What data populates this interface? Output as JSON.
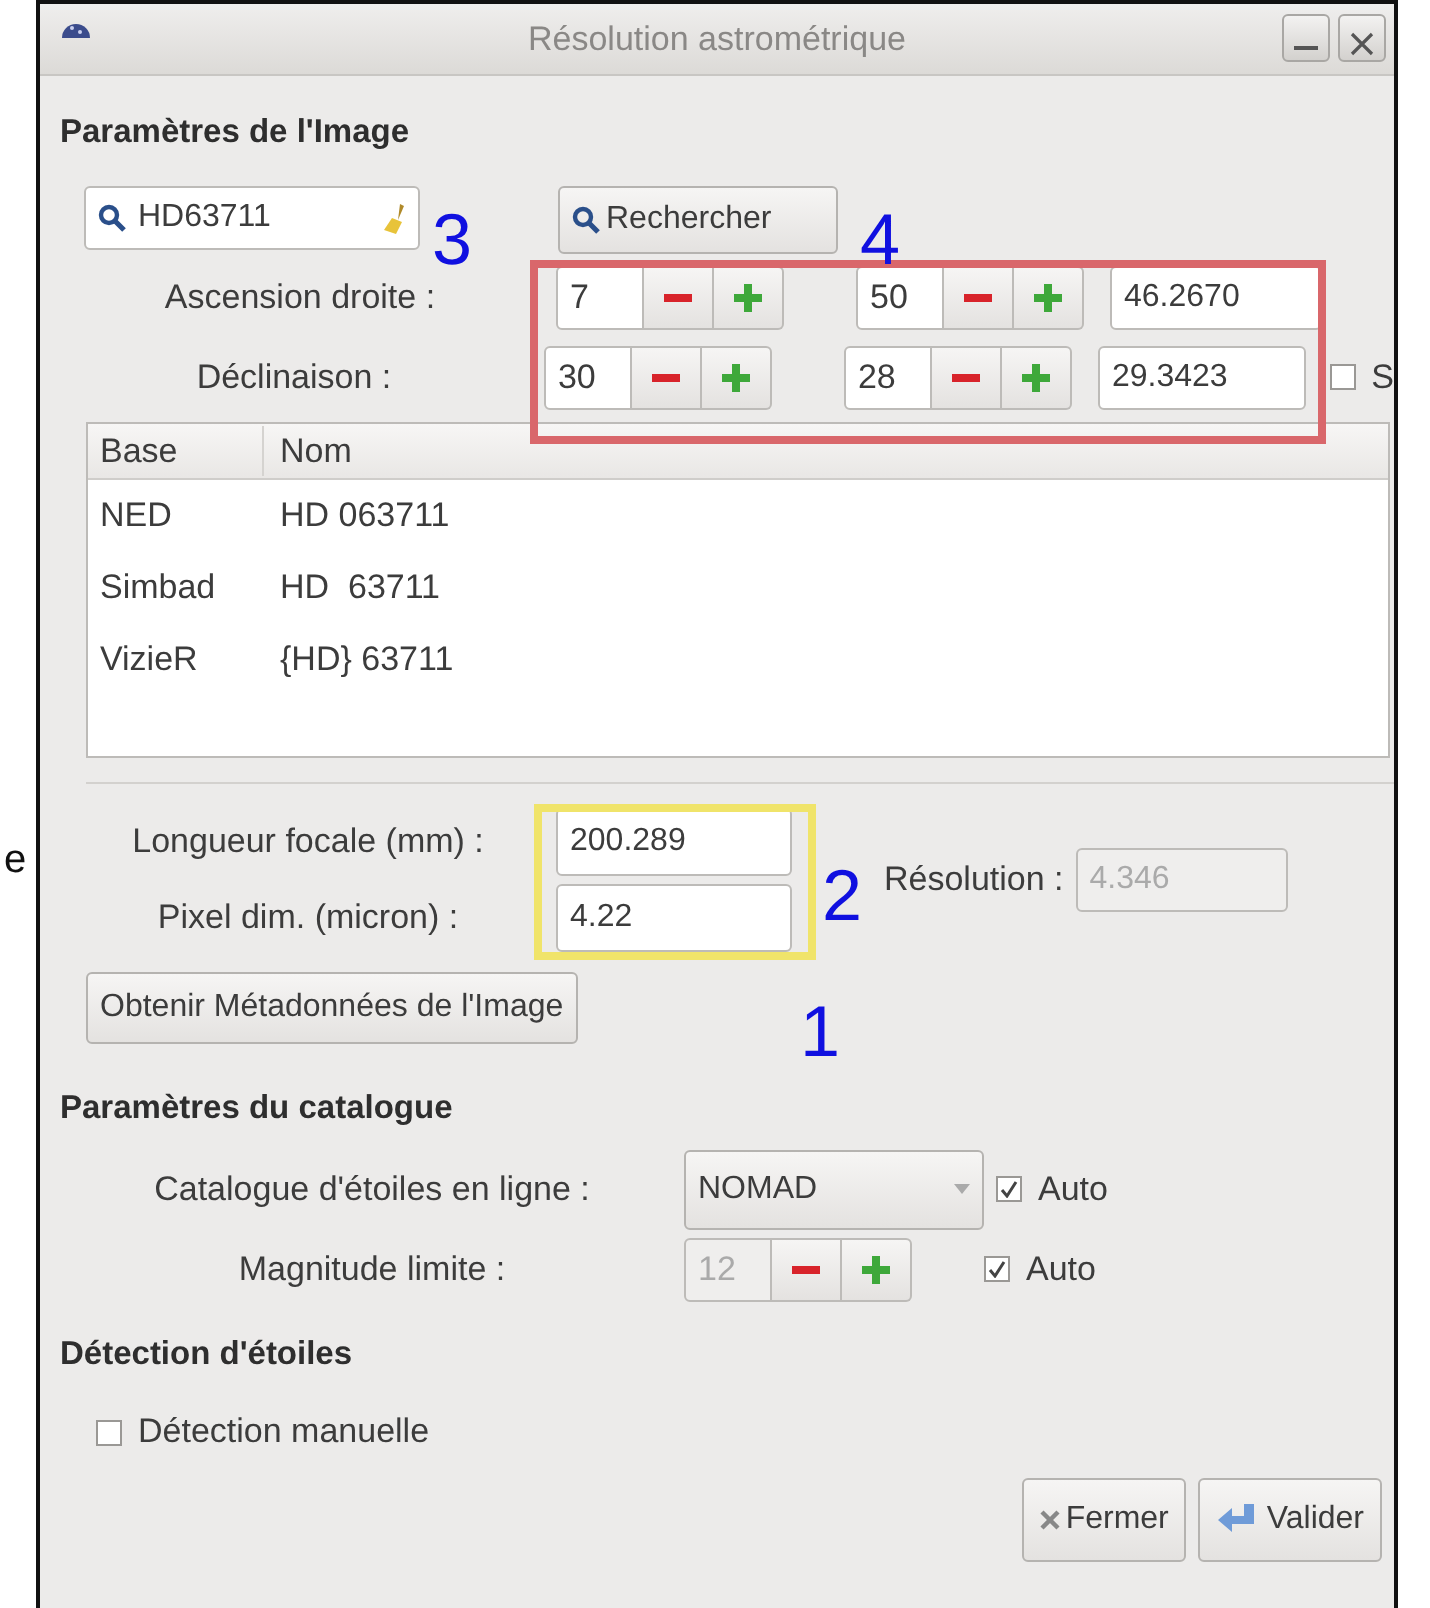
{
  "window": {
    "title": "Résolution astrométrique"
  },
  "background_text": "e",
  "image_params": {
    "heading": "Paramètres de l'Image",
    "search": {
      "value": "HD63711"
    },
    "search_button": "Rechercher",
    "coordinates": [
      {
        "label": "Ascension droite :",
        "spins": [
          "7",
          "50"
        ],
        "field": "46.2670"
      },
      {
        "label": "Déclinaison :",
        "spins": [
          "30",
          "28"
        ],
        "field": "29.3423",
        "checkbox": {
          "label": "S",
          "checked": false
        }
      }
    ],
    "table": {
      "columns": [
        "Base",
        "Nom"
      ],
      "rows": [
        [
          "NED",
          "HD 063711"
        ],
        [
          "Simbad",
          "HD  63711"
        ],
        [
          "VizieR",
          "{HD} 63711"
        ]
      ]
    },
    "focal": {
      "label": "Longueur focale (mm) :",
      "value": "200.289"
    },
    "pixel": {
      "label": "Pixel dim. (micron) :",
      "value": "4.22"
    },
    "resolution": {
      "label": "Résolution :",
      "value": "4.346",
      "disabled": true
    },
    "metadata_button": "Obtenir Métadonnées de l'Image"
  },
  "catalog": {
    "heading": "Paramètres du catalogue",
    "online": {
      "label": "Catalogue d'étoiles en ligne :",
      "value": "NOMAD",
      "auto": {
        "label": "Auto",
        "checked": true
      }
    },
    "magnitude": {
      "label": "Magnitude limite :",
      "value": "12",
      "disabled": true,
      "auto": {
        "label": "Auto",
        "checked": true
      }
    }
  },
  "detection": {
    "heading": "Détection d'étoiles",
    "manual": {
      "label": "Détection manuelle",
      "checked": false
    }
  },
  "buttons": [
    {
      "label": "Fermer",
      "kind": "close"
    },
    {
      "label": "Valider",
      "kind": "confirm"
    }
  ],
  "annotation_frames": [
    {
      "color": "#d9676b"
    },
    {
      "color": "#f0e46a"
    }
  ],
  "annotation_numbers": [
    {
      "label": "3"
    },
    {
      "label": "4"
    },
    {
      "label": "2"
    },
    {
      "label": "1"
    }
  ]
}
